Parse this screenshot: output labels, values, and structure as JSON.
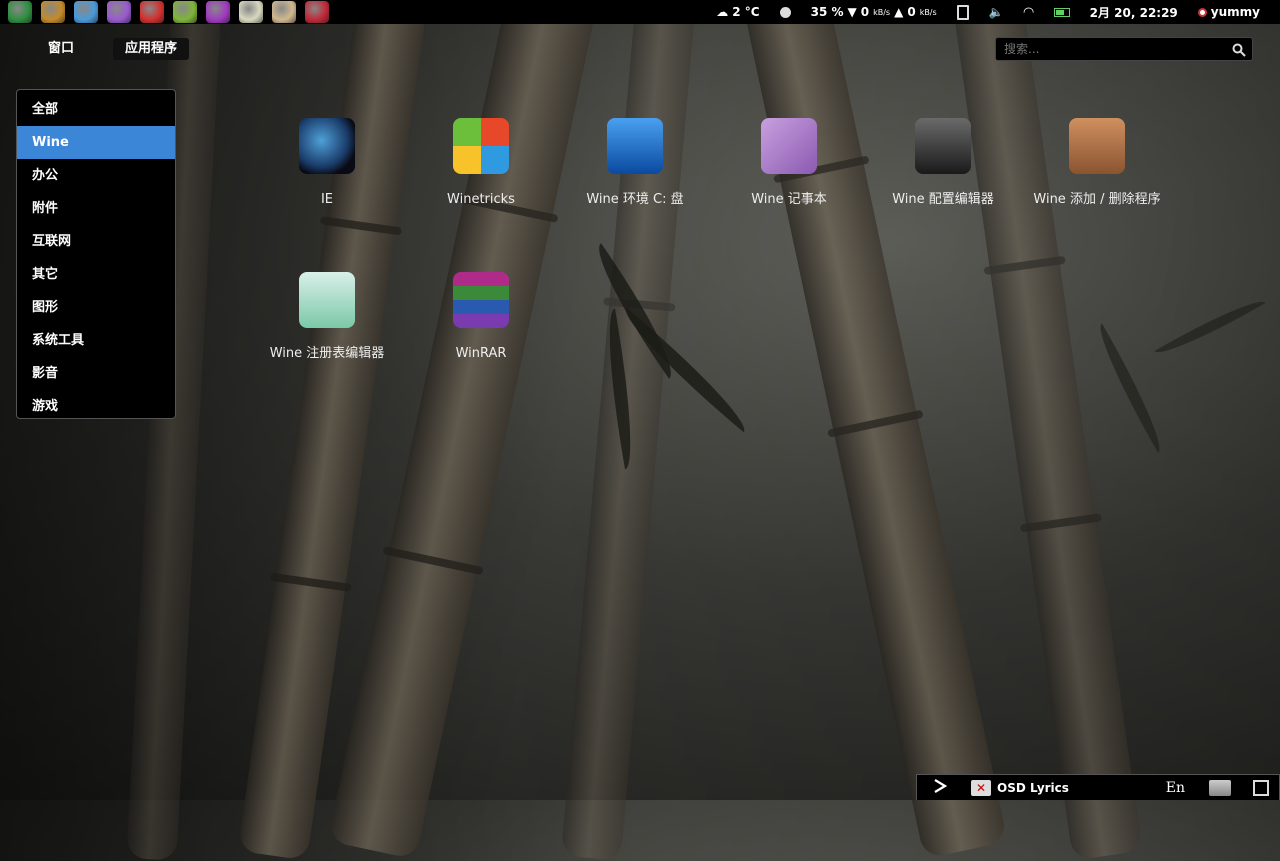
{
  "top_panel": {
    "launchers": [
      {
        "icon": "swirl-app-icon",
        "color": "#2f8f3f"
      },
      {
        "icon": "scanner-app-icon",
        "color": "#c48a2a"
      },
      {
        "icon": "picture-viewer-icon",
        "color": "#4a9ad8"
      },
      {
        "icon": "chat-bubble-icon",
        "color": "#9a5ad0"
      },
      {
        "icon": "angry-bird-icon",
        "color": "#d33030"
      },
      {
        "icon": "android-icon",
        "color": "#7fb43a"
      },
      {
        "icon": "leaf-app-icon",
        "color": "#a03ac0"
      },
      {
        "icon": "cards-app-icon",
        "color": "#d8d8c0"
      },
      {
        "icon": "ninja-app-icon",
        "color": "#d0b890"
      },
      {
        "icon": "zebra-app-icon",
        "color": "#c02a3a"
      }
    ],
    "weather": "2 °C",
    "battery_percent": "35 %",
    "net_down": "0",
    "net_up": "0",
    "net_unit": "kB/s",
    "datetime": "2月 20, 22:29",
    "user": "yummy"
  },
  "overview": {
    "windows_label": "窗口",
    "apps_label": "应用程序",
    "search_placeholder": "搜索..."
  },
  "categories": [
    {
      "label": "全部"
    },
    {
      "label": "Wine"
    },
    {
      "label": "办公"
    },
    {
      "label": "附件"
    },
    {
      "label": "互联网"
    },
    {
      "label": "其它"
    },
    {
      "label": "图形"
    },
    {
      "label": "系统工具"
    },
    {
      "label": "影音"
    },
    {
      "label": "游戏"
    }
  ],
  "active_category": "Wine",
  "apps": [
    {
      "label": "IE",
      "icon": "tcers-globe-icon"
    },
    {
      "label": "Winetricks",
      "icon": "windows-flag-icon"
    },
    {
      "label": "Wine 环境 C: 盘",
      "icon": "home-folder-icon"
    },
    {
      "label": "Wine 记事本",
      "icon": "notepad-pencil-icon"
    },
    {
      "label": "Wine 配置编辑器",
      "icon": "font-config-icon"
    },
    {
      "label": "Wine 添加 / 删除程序",
      "icon": "clipboard-checklist-icon"
    },
    {
      "label": "Wine 注册表编辑器",
      "icon": "registry-card-icon"
    },
    {
      "label": "WinRAR",
      "icon": "winrar-books-icon"
    }
  ],
  "bottom_bar": {
    "osd_label": "OSD Lyrics",
    "input_method": "En"
  }
}
